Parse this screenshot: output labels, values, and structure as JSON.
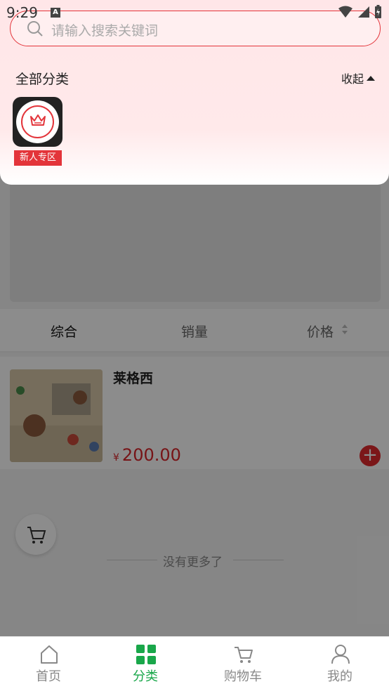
{
  "status": {
    "time": "9:29",
    "a_badge": "A"
  },
  "search": {
    "placeholder": "请输入搜索关键词"
  },
  "category_panel": {
    "title": "全部分类",
    "collapse_label": "收起",
    "items": [
      {
        "label": "新人专区",
        "icon": "crown-icon"
      }
    ]
  },
  "sort_tabs": [
    {
      "label": "综合",
      "active": true
    },
    {
      "label": "销量",
      "active": false
    },
    {
      "label": "价格",
      "active": false
    }
  ],
  "products": [
    {
      "name": "莱格西",
      "currency": "¥",
      "price": "200.00"
    }
  ],
  "list_footer": "没有更多了",
  "tabbar": [
    {
      "label": "首页",
      "icon": "home-icon",
      "active": false
    },
    {
      "label": "分类",
      "icon": "category-grid-icon",
      "active": true
    },
    {
      "label": "购物车",
      "icon": "cart-icon",
      "active": false
    },
    {
      "label": "我的",
      "icon": "user-icon",
      "active": false
    }
  ],
  "colors": {
    "accent_red": "#e3343a",
    "active_green": "#19a74a",
    "price_red": "#d9252b"
  }
}
